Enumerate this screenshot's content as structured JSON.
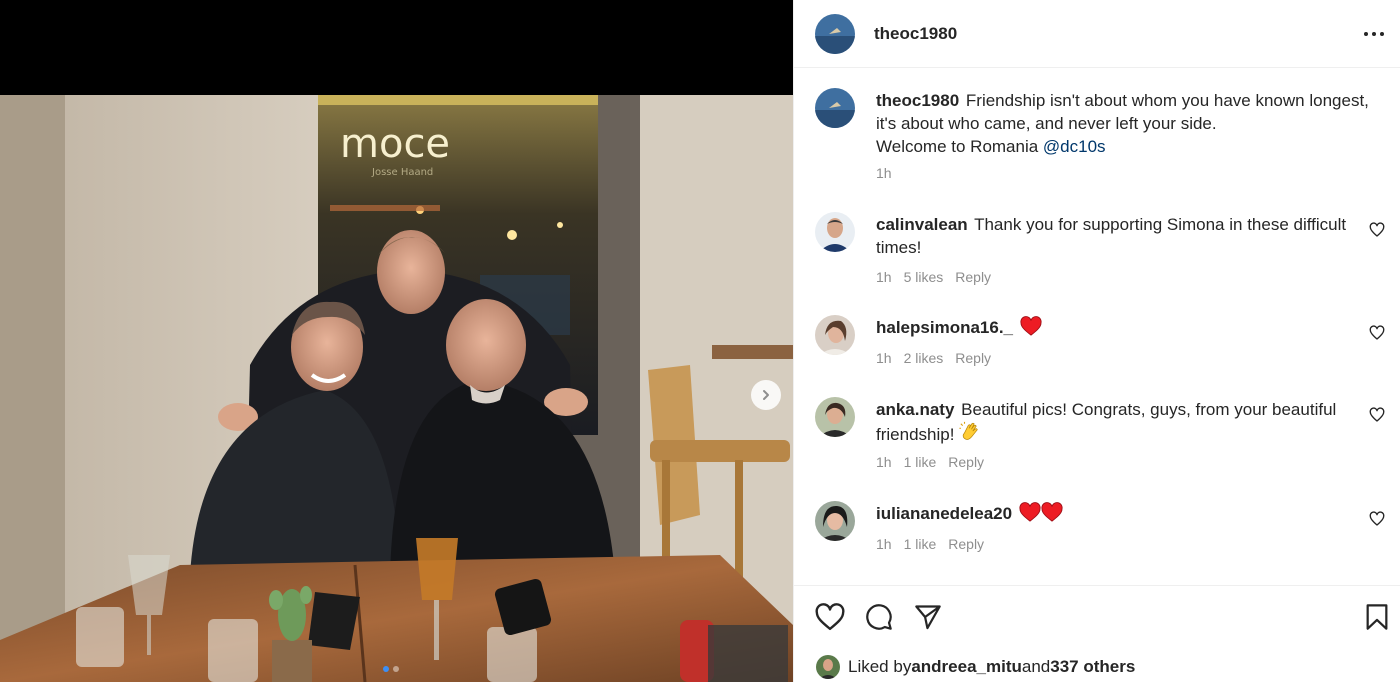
{
  "post": {
    "author": "theoc1980",
    "more_icon": "more-horizontal-icon"
  },
  "caption": {
    "username": "theoc1980",
    "text_line1": "Friendship isn't about whom you have known longest, it's about who came, and never left your side.",
    "text_line2": "Welcome to Romania ",
    "mention": "@dc10s",
    "time": "1h"
  },
  "comments": [
    {
      "username": "calinvalean",
      "text": "Thank you for supporting Simona in these difficult times!",
      "time": "1h",
      "likes": "5 likes",
      "reply": "Reply"
    },
    {
      "username": "halepsimona16._",
      "text": "",
      "emoji": [
        "red-heart"
      ],
      "time": "1h",
      "likes": "2 likes",
      "reply": "Reply"
    },
    {
      "username": "anka.naty",
      "text": "Beautiful pics! Congrats, guys, from your beautiful friendship!",
      "emoji": [
        "clapping-hands"
      ],
      "time": "1h",
      "likes": "1 like",
      "reply": "Reply"
    },
    {
      "username": "iuliananedelea20",
      "text": "",
      "emoji": [
        "red-heart",
        "red-heart"
      ],
      "time": "1h",
      "likes": "1 like",
      "reply": "Reply"
    }
  ],
  "likes_summary": {
    "prefix": "Liked by ",
    "user": "andreea_mitu",
    "middle": " and ",
    "others": "337 others"
  },
  "photo": {
    "sign_text": "moce",
    "carousel_index": 1,
    "carousel_total": 2
  },
  "colors": {
    "accent": "#3d8ff5",
    "mention": "#00376b",
    "muted": "#8e8e8e",
    "heart": "#ed1c24"
  }
}
